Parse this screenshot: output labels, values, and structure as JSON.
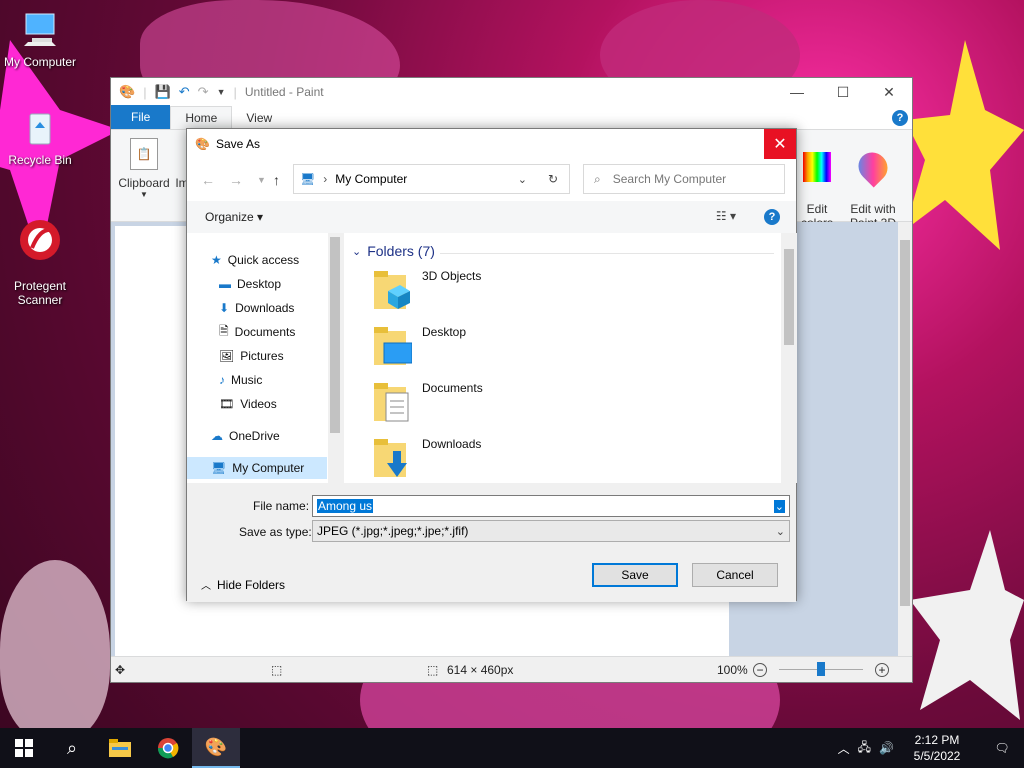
{
  "desktop": {
    "icons": [
      {
        "label": "My Computer"
      },
      {
        "label": "Recycle Bin"
      },
      {
        "label": "Protegent\nScanner"
      }
    ]
  },
  "paint": {
    "title": "Untitled - Paint",
    "tabs": [
      "File",
      "Home",
      "View"
    ],
    "ribbon": {
      "clipboard": "Clipboard",
      "images_partial": "Im",
      "edit_colors": "Edit\ncolors",
      "edit_paint3d": "Edit with\nPaint 3D"
    },
    "status": {
      "dimensions": "614 × 460px",
      "zoom": "100%"
    },
    "window_controls": {
      "minimize": "—",
      "maximize": "☐",
      "close": "✕"
    },
    "help": "?"
  },
  "dialog": {
    "title": "Save As",
    "close": "✕",
    "address": "My Computer",
    "search_placeholder": "Search My Computer",
    "organize": "Organize",
    "help": "?",
    "nav": {
      "quick_access": "Quick access",
      "items": [
        {
          "label": "Desktop",
          "pinned": true
        },
        {
          "label": "Downloads",
          "pinned": true
        },
        {
          "label": "Documents",
          "pinned": true
        },
        {
          "label": "Pictures",
          "pinned": true
        },
        {
          "label": "Music",
          "pinned": false
        },
        {
          "label": "Videos",
          "pinned": false
        }
      ],
      "onedrive": "OneDrive",
      "my_computer": "My Computer"
    },
    "content": {
      "group_header": "Folders (7)",
      "folders": [
        "3D Objects",
        "Desktop",
        "Documents",
        "Downloads"
      ]
    },
    "filename_label": "File name:",
    "filename_value": "Among us",
    "filetype_label": "Save as type:",
    "filetype_value": "JPEG (*.jpg;*.jpeg;*.jpe;*.jfif)",
    "hide_folders": "Hide Folders",
    "save": "Save",
    "cancel": "Cancel"
  },
  "taskbar": {
    "time": "2:12 PM",
    "date": "5/5/2022"
  }
}
